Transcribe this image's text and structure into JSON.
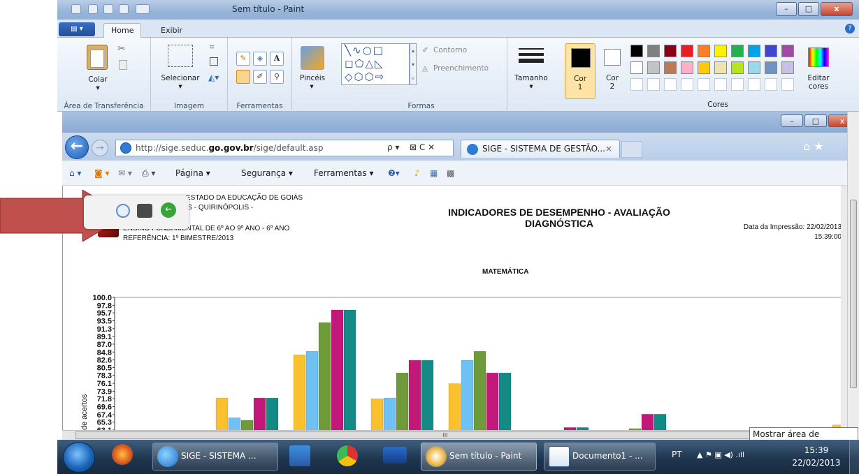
{
  "paint": {
    "window_title": "Sem título - Paint",
    "window_buttons": {
      "minimize": "–",
      "maximize": "□",
      "close": "x"
    },
    "tabs": [
      "Home",
      "Exibir"
    ],
    "help_glyph": "?",
    "groups": {
      "clipboard": {
        "label": "Área de Transferência",
        "paste": "Colar"
      },
      "image": {
        "label": "Imagem",
        "select": "Selecionar"
      },
      "tools": {
        "label": "Ferramentas",
        "text_tool": "A"
      },
      "brushes": {
        "label": "Pincéis"
      },
      "shapes": {
        "label": "Formas",
        "outline": "Contorno",
        "fill": "Preenchimento"
      },
      "size": {
        "label": "Tamanho"
      },
      "color1": {
        "label": "Cor",
        "sub": "1"
      },
      "color2": {
        "label": "Cor",
        "sub": "2"
      },
      "colors": {
        "label": "Cores",
        "edit": "Editar",
        "edit2": "cores"
      }
    },
    "palette_row1": [
      "#000000",
      "#7f7f7f",
      "#880015",
      "#ed1c24",
      "#ff7f27",
      "#fff200",
      "#22b14c",
      "#00a2e8",
      "#3f48cc",
      "#a349a4"
    ],
    "palette_row2": [
      "#ffffff",
      "#c3c3c3",
      "#b97a57",
      "#ffaec9",
      "#ffc90e",
      "#efe4b0",
      "#b5e61d",
      "#99d9ea",
      "#7092be",
      "#c8bfe7"
    ]
  },
  "ie": {
    "url_prefix": "http://sige.seduc.",
    "url_bold": "go.gov.br",
    "url_suffix": "/sige/default.asp",
    "tab_title": "SIGE - SISTEMA DE GESTÃO...",
    "tab_close": "×",
    "search_glyph": "ρ ▾",
    "reload_stop": "⊠ C ✕",
    "back": "←",
    "forward": "→",
    "toolbar": [
      "Página ▾",
      "Segurança ▾",
      "Ferramentas ▾"
    ],
    "right_icons": "⌂ ★"
  },
  "report": {
    "header_line1": "ESTADO DA EDUCAÇÃO DE GOIÁS",
    "header_line2": "LIS - QUIRINÓPOLIS -",
    "header_line3": "ENSINO FUNDAMENTAL DE 6º AO 9º ANO - 6º ANO",
    "header_line4": "REFERÊNCIA: 1º BIMESTRE/2013",
    "title_line1": "INDICADORES DE DESEMPENHO - AVALIAÇÃO",
    "title_line2": "DIAGNÓSTICA",
    "print_date": "Data da Impressão: 22/02/2013",
    "print_time": "15:39:00"
  },
  "chart_data": {
    "type": "bar",
    "title": "MATEMÁTICA",
    "ylabel": "de acertos",
    "ylim": [
      63.1,
      100.0
    ],
    "yticks": [
      "100.0",
      "97.8",
      "95.7",
      "93.5",
      "91.3",
      "89.1",
      "87.0",
      "84.8",
      "82.6",
      "80.5",
      "78.3",
      "76.1",
      "73.9",
      "71.8",
      "69.6",
      "67.4",
      "65.3",
      "63.1"
    ],
    "series_colors": [
      "#fbc02d",
      "#6ec1f2",
      "#6e9a3a",
      "#c2187a",
      "#138a86"
    ],
    "groups": [
      {
        "values": [
          72.0,
          66.5,
          65.8,
          72.0,
          72.0
        ]
      },
      {
        "values": [
          84.0,
          85.0,
          93.0,
          96.5,
          96.5
        ]
      },
      {
        "values": [
          71.8,
          72.0,
          79.0,
          82.5,
          82.5
        ]
      },
      {
        "values": [
          76.0,
          82.5,
          85.0,
          79.0,
          79.0
        ]
      },
      {
        "values": [
          null,
          null,
          null,
          63.8,
          63.8
        ]
      },
      {
        "values": [
          null,
          null,
          63.5,
          67.5,
          67.5
        ]
      },
      {
        "values": [
          null,
          null,
          62.5,
          null,
          null
        ]
      },
      {
        "values": [
          64.5,
          null,
          null,
          null,
          null
        ]
      }
    ]
  },
  "overlay": {
    "scroll_label": "III",
    "tooltip": "Mostrar área de trabalho"
  },
  "taskbar": {
    "items": [
      "SIGE - SISTEMA ...",
      "Sem título - Paint",
      "Documento1 - ..."
    ],
    "lang": "PT",
    "time": "15:39",
    "date": "22/02/2013",
    "tray_glyphs": "▲  ⚑  ▣  ◀) .ıll"
  }
}
